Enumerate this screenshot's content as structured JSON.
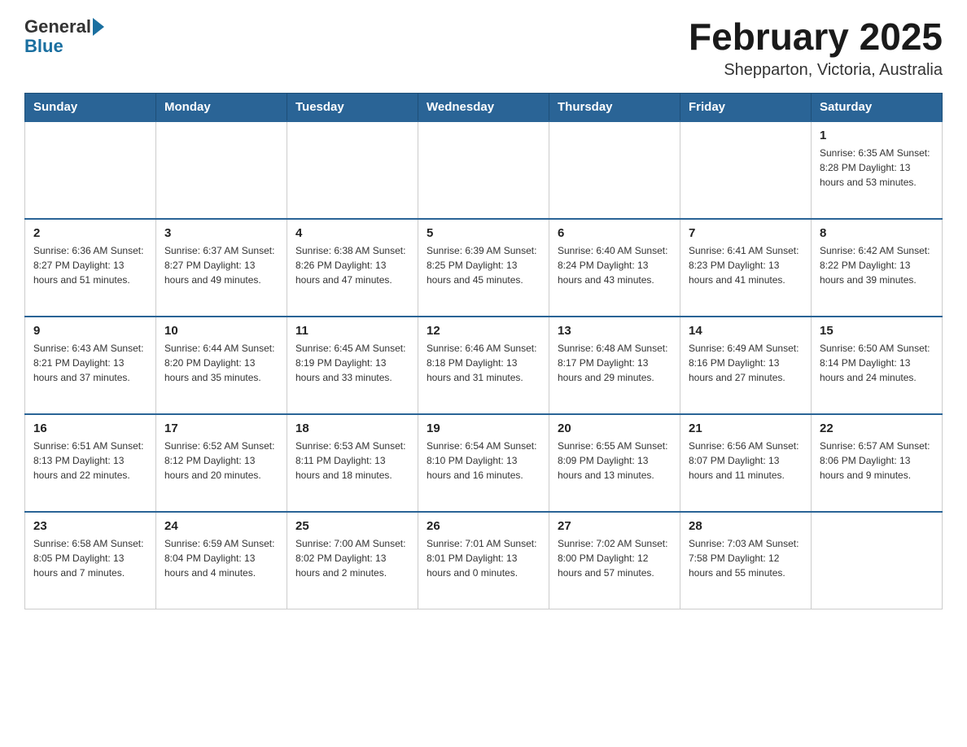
{
  "logo": {
    "text_general": "General",
    "text_blue": "Blue"
  },
  "header": {
    "title": "February 2025",
    "subtitle": "Shepparton, Victoria, Australia"
  },
  "weekdays": [
    "Sunday",
    "Monday",
    "Tuesday",
    "Wednesday",
    "Thursday",
    "Friday",
    "Saturday"
  ],
  "weeks": [
    [
      {
        "day": "",
        "info": ""
      },
      {
        "day": "",
        "info": ""
      },
      {
        "day": "",
        "info": ""
      },
      {
        "day": "",
        "info": ""
      },
      {
        "day": "",
        "info": ""
      },
      {
        "day": "",
        "info": ""
      },
      {
        "day": "1",
        "info": "Sunrise: 6:35 AM\nSunset: 8:28 PM\nDaylight: 13 hours\nand 53 minutes."
      }
    ],
    [
      {
        "day": "2",
        "info": "Sunrise: 6:36 AM\nSunset: 8:27 PM\nDaylight: 13 hours\nand 51 minutes."
      },
      {
        "day": "3",
        "info": "Sunrise: 6:37 AM\nSunset: 8:27 PM\nDaylight: 13 hours\nand 49 minutes."
      },
      {
        "day": "4",
        "info": "Sunrise: 6:38 AM\nSunset: 8:26 PM\nDaylight: 13 hours\nand 47 minutes."
      },
      {
        "day": "5",
        "info": "Sunrise: 6:39 AM\nSunset: 8:25 PM\nDaylight: 13 hours\nand 45 minutes."
      },
      {
        "day": "6",
        "info": "Sunrise: 6:40 AM\nSunset: 8:24 PM\nDaylight: 13 hours\nand 43 minutes."
      },
      {
        "day": "7",
        "info": "Sunrise: 6:41 AM\nSunset: 8:23 PM\nDaylight: 13 hours\nand 41 minutes."
      },
      {
        "day": "8",
        "info": "Sunrise: 6:42 AM\nSunset: 8:22 PM\nDaylight: 13 hours\nand 39 minutes."
      }
    ],
    [
      {
        "day": "9",
        "info": "Sunrise: 6:43 AM\nSunset: 8:21 PM\nDaylight: 13 hours\nand 37 minutes."
      },
      {
        "day": "10",
        "info": "Sunrise: 6:44 AM\nSunset: 8:20 PM\nDaylight: 13 hours\nand 35 minutes."
      },
      {
        "day": "11",
        "info": "Sunrise: 6:45 AM\nSunset: 8:19 PM\nDaylight: 13 hours\nand 33 minutes."
      },
      {
        "day": "12",
        "info": "Sunrise: 6:46 AM\nSunset: 8:18 PM\nDaylight: 13 hours\nand 31 minutes."
      },
      {
        "day": "13",
        "info": "Sunrise: 6:48 AM\nSunset: 8:17 PM\nDaylight: 13 hours\nand 29 minutes."
      },
      {
        "day": "14",
        "info": "Sunrise: 6:49 AM\nSunset: 8:16 PM\nDaylight: 13 hours\nand 27 minutes."
      },
      {
        "day": "15",
        "info": "Sunrise: 6:50 AM\nSunset: 8:14 PM\nDaylight: 13 hours\nand 24 minutes."
      }
    ],
    [
      {
        "day": "16",
        "info": "Sunrise: 6:51 AM\nSunset: 8:13 PM\nDaylight: 13 hours\nand 22 minutes."
      },
      {
        "day": "17",
        "info": "Sunrise: 6:52 AM\nSunset: 8:12 PM\nDaylight: 13 hours\nand 20 minutes."
      },
      {
        "day": "18",
        "info": "Sunrise: 6:53 AM\nSunset: 8:11 PM\nDaylight: 13 hours\nand 18 minutes."
      },
      {
        "day": "19",
        "info": "Sunrise: 6:54 AM\nSunset: 8:10 PM\nDaylight: 13 hours\nand 16 minutes."
      },
      {
        "day": "20",
        "info": "Sunrise: 6:55 AM\nSunset: 8:09 PM\nDaylight: 13 hours\nand 13 minutes."
      },
      {
        "day": "21",
        "info": "Sunrise: 6:56 AM\nSunset: 8:07 PM\nDaylight: 13 hours\nand 11 minutes."
      },
      {
        "day": "22",
        "info": "Sunrise: 6:57 AM\nSunset: 8:06 PM\nDaylight: 13 hours\nand 9 minutes."
      }
    ],
    [
      {
        "day": "23",
        "info": "Sunrise: 6:58 AM\nSunset: 8:05 PM\nDaylight: 13 hours\nand 7 minutes."
      },
      {
        "day": "24",
        "info": "Sunrise: 6:59 AM\nSunset: 8:04 PM\nDaylight: 13 hours\nand 4 minutes."
      },
      {
        "day": "25",
        "info": "Sunrise: 7:00 AM\nSunset: 8:02 PM\nDaylight: 13 hours\nand 2 minutes."
      },
      {
        "day": "26",
        "info": "Sunrise: 7:01 AM\nSunset: 8:01 PM\nDaylight: 13 hours\nand 0 minutes."
      },
      {
        "day": "27",
        "info": "Sunrise: 7:02 AM\nSunset: 8:00 PM\nDaylight: 12 hours\nand 57 minutes."
      },
      {
        "day": "28",
        "info": "Sunrise: 7:03 AM\nSunset: 7:58 PM\nDaylight: 12 hours\nand 55 minutes."
      },
      {
        "day": "",
        "info": ""
      }
    ]
  ]
}
